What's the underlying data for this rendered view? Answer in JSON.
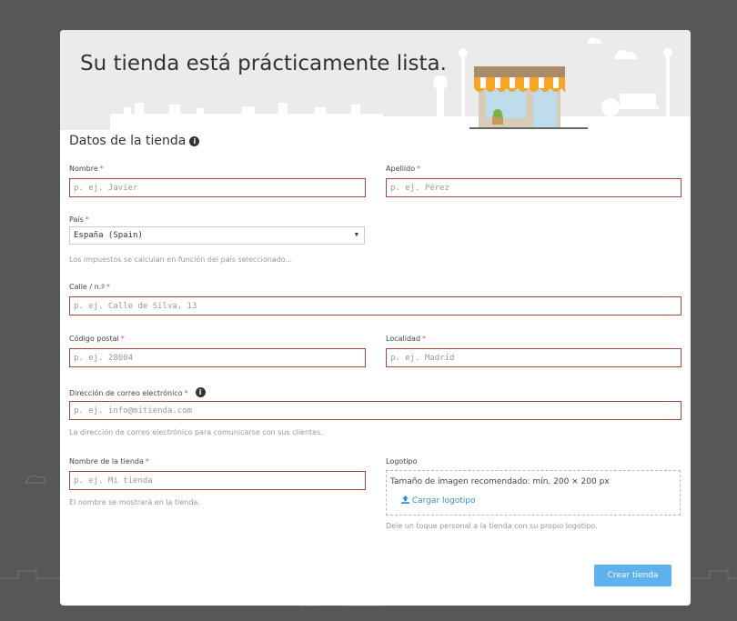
{
  "banner": {
    "title": "Su tienda está prácticamente lista."
  },
  "section": {
    "title": "Datos de la tienda"
  },
  "form": {
    "required_mark": "*",
    "first_name": {
      "label": "Nombre",
      "placeholder": "p. ej. Javier"
    },
    "last_name": {
      "label": "Apellido",
      "placeholder": "p. ej. Pérez"
    },
    "country": {
      "label": "País",
      "value": "España (Spain)",
      "help": "Los impuestos se calculan en función del país seleccionado..."
    },
    "street": {
      "label": "Calle / n.º",
      "placeholder": "p. ej. Calle de Silva, 13"
    },
    "postal_code": {
      "label": "Código postal",
      "placeholder": "p. ej. 28004"
    },
    "city": {
      "label": "Localidad",
      "placeholder": "p. ej. Madrid"
    },
    "email": {
      "label": "Dirección de correo electrónico",
      "placeholder": "p. ej. info@mitienda.com",
      "help": "La dirección de correo electrónico para comunicarse con sus clientes."
    },
    "store_name": {
      "label": "Nombre de la tienda",
      "placeholder": "p. ej. Mi tienda",
      "help": "El nombre se mostrará en la tienda."
    },
    "logo": {
      "label": "Logotipo",
      "size_hint": "Tamaño de imagen recomendado: mín. 200 × 200 px",
      "upload_label": "Cargar logotipo",
      "help": "Dele un toque personal a la tienda con su propio logotipo."
    }
  },
  "actions": {
    "create_label": "Crear tienda"
  },
  "colors": {
    "accent": "#5db1ee",
    "error_border": "#a94442",
    "required": "#d9534f",
    "awning": "#f5a623"
  },
  "icons": {
    "info": "info-icon",
    "upload": "upload-icon",
    "caret": "chevron-down-icon"
  }
}
